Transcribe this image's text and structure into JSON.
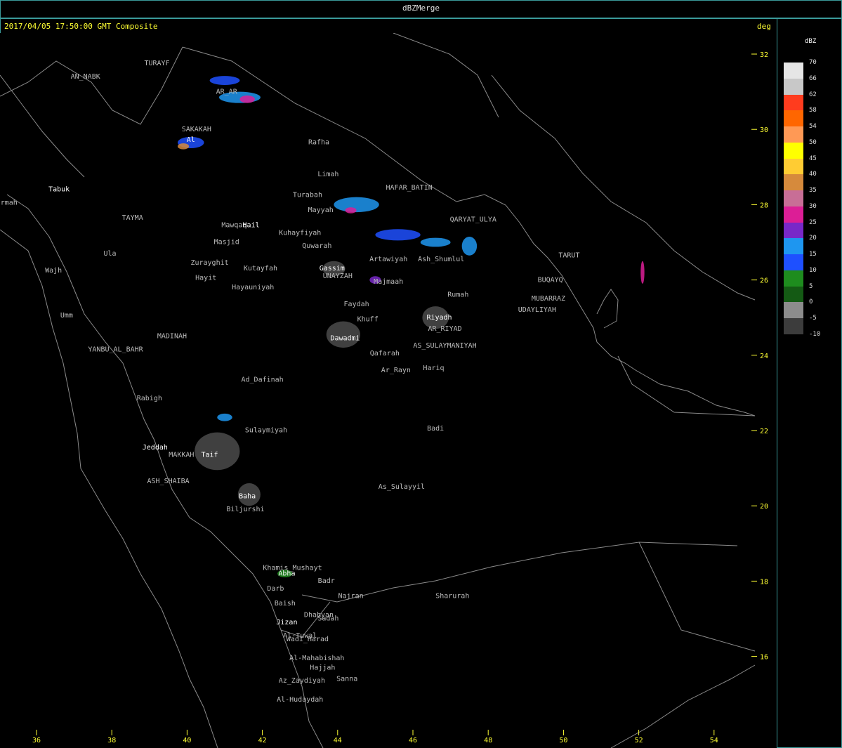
{
  "window": {
    "title": "dBZMerge"
  },
  "header": {
    "timestamp": "2017/04/05 17:50:00 GMT Composite"
  },
  "axes": {
    "unit": "deg",
    "lat_ticks": [
      "32",
      "30",
      "28",
      "26",
      "24",
      "22",
      "20",
      "18",
      "16"
    ],
    "lon_ticks": [
      "36",
      "38",
      "40",
      "42",
      "44",
      "46",
      "48",
      "50",
      "52",
      "54"
    ]
  },
  "legend": {
    "title": "dBZ",
    "levels": [
      {
        "label": "70",
        "color": "#e6e6e6"
      },
      {
        "label": "66",
        "color": "#c8c8c8"
      },
      {
        "label": "62",
        "color": "#ff3c1e"
      },
      {
        "label": "58",
        "color": "#ff6600"
      },
      {
        "label": "54",
        "color": "#ff9955"
      },
      {
        "label": "50",
        "color": "#ffff00"
      },
      {
        "label": "45",
        "color": "#ffcc33"
      },
      {
        "label": "40",
        "color": "#d68a3c"
      },
      {
        "label": "35",
        "color": "#c86e96"
      },
      {
        "label": "30",
        "color": "#dc1e96"
      },
      {
        "label": "25",
        "color": "#7828c8"
      },
      {
        "label": "20",
        "color": "#1e96f0"
      },
      {
        "label": "15",
        "color": "#1e50ff"
      },
      {
        "label": "10",
        "color": "#1e8c1e"
      },
      {
        "label": "5",
        "color": "#145a14"
      },
      {
        "label": "0",
        "color": "#8c8c8c"
      },
      {
        "label": "-5",
        "color": "#3c3c3c"
      }
    ],
    "min_label": "-10"
  },
  "places": [
    {
      "name": "TURAYF",
      "lon": 39.2,
      "lat": 31.7,
      "color": "#bbbbbb"
    },
    {
      "name": "AN_NABK",
      "lon": 37.3,
      "lat": 31.35,
      "color": "#bbbbbb"
    },
    {
      "name": "AR_AR",
      "lon": 41.05,
      "lat": 30.95,
      "color": "#bbbbbb"
    },
    {
      "name": "SAKAKAH",
      "lon": 40.25,
      "lat": 29.95,
      "color": "#bbbbbb"
    },
    {
      "name": "Al",
      "lon": 40.1,
      "lat": 29.67,
      "color": "#ffffff"
    },
    {
      "name": "Rafha",
      "lon": 43.5,
      "lat": 29.6,
      "color": "#bbbbbb"
    },
    {
      "name": "Limah",
      "lon": 43.75,
      "lat": 28.75,
      "color": "#bbbbbb"
    },
    {
      "name": "HAFAR_BATIN",
      "lon": 45.9,
      "lat": 28.4,
      "color": "#bbbbbb"
    },
    {
      "name": "Tabuk",
      "lon": 36.6,
      "lat": 28.35,
      "color": "#ffffff"
    },
    {
      "name": "Sharmah",
      "lon": 35.1,
      "lat": 28.0,
      "color": "#bbbbbb"
    },
    {
      "name": "Turabah",
      "lon": 43.2,
      "lat": 28.2,
      "color": "#bbbbbb"
    },
    {
      "name": "Mayyah",
      "lon": 43.55,
      "lat": 27.8,
      "color": "#bbbbbb"
    },
    {
      "name": "TAYMA",
      "lon": 38.55,
      "lat": 27.6,
      "color": "#bbbbbb"
    },
    {
      "name": "QARYAT_ULYA",
      "lon": 47.6,
      "lat": 27.55,
      "color": "#bbbbbb"
    },
    {
      "name": "Mawqaq",
      "lon": 41.25,
      "lat": 27.4,
      "color": "#bbbbbb"
    },
    {
      "name": "Hail",
      "lon": 41.7,
      "lat": 27.4,
      "color": "#ffffff"
    },
    {
      "name": "Kuhayfiyah",
      "lon": 43.0,
      "lat": 27.2,
      "color": "#bbbbbb"
    },
    {
      "name": "Masjid",
      "lon": 41.05,
      "lat": 26.95,
      "color": "#bbbbbb"
    },
    {
      "name": "Quwarah",
      "lon": 43.45,
      "lat": 26.85,
      "color": "#bbbbbb"
    },
    {
      "name": "Ula",
      "lon": 37.95,
      "lat": 26.65,
      "color": "#bbbbbb"
    },
    {
      "name": "Artawiyah",
      "lon": 45.35,
      "lat": 26.5,
      "color": "#bbbbbb"
    },
    {
      "name": "Ash_Shumlul",
      "lon": 46.75,
      "lat": 26.5,
      "color": "#bbbbbb"
    },
    {
      "name": "TARUT",
      "lon": 50.15,
      "lat": 26.6,
      "color": "#bbbbbb"
    },
    {
      "name": "Zurayghit",
      "lon": 40.6,
      "lat": 26.4,
      "color": "#bbbbbb"
    },
    {
      "name": "Kutayfah",
      "lon": 41.95,
      "lat": 26.25,
      "color": "#bbbbbb"
    },
    {
      "name": "Gassim",
      "lon": 43.85,
      "lat": 26.25,
      "color": "#ffffff"
    },
    {
      "name": "UNAYZAH",
      "lon": 44.0,
      "lat": 26.05,
      "color": "#bbbbbb"
    },
    {
      "name": "Wajh",
      "lon": 36.45,
      "lat": 26.2,
      "color": "#bbbbbb"
    },
    {
      "name": "Hayit",
      "lon": 40.5,
      "lat": 26.0,
      "color": "#bbbbbb"
    },
    {
      "name": "Majmaah",
      "lon": 45.35,
      "lat": 25.9,
      "color": "#bbbbbb"
    },
    {
      "name": "BUQAYQ",
      "lon": 49.65,
      "lat": 25.95,
      "color": "#bbbbbb"
    },
    {
      "name": "Hayauniyah",
      "lon": 41.75,
      "lat": 25.75,
      "color": "#bbbbbb"
    },
    {
      "name": "Rumah",
      "lon": 47.2,
      "lat": 25.55,
      "color": "#bbbbbb"
    },
    {
      "name": "MUBARRAZ",
      "lon": 49.6,
      "lat": 25.45,
      "color": "#bbbbbb"
    },
    {
      "name": "Faydah",
      "lon": 44.5,
      "lat": 25.3,
      "color": "#bbbbbb"
    },
    {
      "name": "UDAYLIYAH",
      "lon": 49.3,
      "lat": 25.15,
      "color": "#bbbbbb"
    },
    {
      "name": "Umm",
      "lon": 36.8,
      "lat": 25.0,
      "color": "#bbbbbb"
    },
    {
      "name": "Riyadh",
      "lon": 46.7,
      "lat": 24.95,
      "color": "#ffffff"
    },
    {
      "name": "Khuff",
      "lon": 44.8,
      "lat": 24.9,
      "color": "#bbbbbb"
    },
    {
      "name": "AR_RIYAD",
      "lon": 46.85,
      "lat": 24.65,
      "color": "#bbbbbb"
    },
    {
      "name": "MADINAH",
      "lon": 39.6,
      "lat": 24.45,
      "color": "#bbbbbb"
    },
    {
      "name": "Dawadmi",
      "lon": 44.2,
      "lat": 24.4,
      "color": "#ffffff"
    },
    {
      "name": "AS_SULAYMANIYAH",
      "lon": 46.85,
      "lat": 24.2,
      "color": "#bbbbbb"
    },
    {
      "name": "YANBU_AL_BAHR",
      "lon": 38.1,
      "lat": 24.1,
      "color": "#bbbbbb"
    },
    {
      "name": "Qafarah",
      "lon": 45.25,
      "lat": 24.0,
      "color": "#bbbbbb"
    },
    {
      "name": "Hariq",
      "lon": 46.55,
      "lat": 23.6,
      "color": "#bbbbbb"
    },
    {
      "name": "Ar_Rayn",
      "lon": 45.55,
      "lat": 23.55,
      "color": "#bbbbbb"
    },
    {
      "name": "Ad_Dafinah",
      "lon": 42.0,
      "lat": 23.3,
      "color": "#bbbbbb"
    },
    {
      "name": "Rabigh",
      "lon": 39.0,
      "lat": 22.8,
      "color": "#bbbbbb"
    },
    {
      "name": "Badi",
      "lon": 46.6,
      "lat": 22.0,
      "color": "#bbbbbb"
    },
    {
      "name": "Sulaymiyah",
      "lon": 42.1,
      "lat": 21.95,
      "color": "#bbbbbb"
    },
    {
      "name": "Jeddah",
      "lon": 39.15,
      "lat": 21.5,
      "color": "#ffffff"
    },
    {
      "name": "MAKKAH",
      "lon": 39.85,
      "lat": 21.3,
      "color": "#bbbbbb"
    },
    {
      "name": "Taif",
      "lon": 40.6,
      "lat": 21.3,
      "color": "#ffffff"
    },
    {
      "name": "ASH_SHAIBA",
      "lon": 39.5,
      "lat": 20.6,
      "color": "#bbbbbb"
    },
    {
      "name": "As_Sulayyil",
      "lon": 45.7,
      "lat": 20.45,
      "color": "#bbbbbb"
    },
    {
      "name": "Baha",
      "lon": 41.6,
      "lat": 20.2,
      "color": "#ffffff"
    },
    {
      "name": "Biljurshi",
      "lon": 41.55,
      "lat": 19.85,
      "color": "#bbbbbb"
    },
    {
      "name": "Khamis_Mushayt",
      "lon": 42.8,
      "lat": 18.3,
      "color": "#bbbbbb"
    },
    {
      "name": "Abha",
      "lon": 42.65,
      "lat": 18.15,
      "color": "#ffffff"
    },
    {
      "name": "Badr",
      "lon": 43.7,
      "lat": 17.95,
      "color": "#bbbbbb"
    },
    {
      "name": "Darb",
      "lon": 42.35,
      "lat": 17.75,
      "color": "#bbbbbb"
    },
    {
      "name": "Najran",
      "lon": 44.35,
      "lat": 17.55,
      "color": "#bbbbbb"
    },
    {
      "name": "Sharurah",
      "lon": 47.05,
      "lat": 17.55,
      "color": "#bbbbbb"
    },
    {
      "name": "Baish",
      "lon": 42.6,
      "lat": 17.35,
      "color": "#bbbbbb"
    },
    {
      "name": "Dhahyan",
      "lon": 43.5,
      "lat": 17.05,
      "color": "#bbbbbb"
    },
    {
      "name": "Sadah",
      "lon": 43.75,
      "lat": 16.95,
      "color": "#bbbbbb"
    },
    {
      "name": "Jizan",
      "lon": 42.65,
      "lat": 16.85,
      "color": "#ffffff"
    },
    {
      "name": "Al-Tuwal",
      "lon": 43.0,
      "lat": 16.5,
      "color": "#bbbbbb"
    },
    {
      "name": "Wadi_Harad",
      "lon": 43.2,
      "lat": 16.4,
      "color": "#bbbbbb"
    },
    {
      "name": "Al-Mahabishah",
      "lon": 43.45,
      "lat": 15.9,
      "color": "#bbbbbb"
    },
    {
      "name": "Hajjah",
      "lon": 43.6,
      "lat": 15.65,
      "color": "#bbbbbb"
    },
    {
      "name": "Az_Zaydiyah",
      "lon": 43.05,
      "lat": 15.3,
      "color": "#bbbbbb"
    },
    {
      "name": "Sanna",
      "lon": 44.25,
      "lat": 15.35,
      "color": "#bbbbbb"
    },
    {
      "name": "Al-Hudaydah",
      "lon": 43.0,
      "lat": 14.8,
      "color": "#bbbbbb"
    }
  ],
  "echoes": [
    {
      "lon": 41.0,
      "lat": 31.3,
      "rx": 0.4,
      "ry": 0.12,
      "dbz": 15
    },
    {
      "lon": 41.4,
      "lat": 30.85,
      "rx": 0.55,
      "ry": 0.15,
      "dbz": 20
    },
    {
      "lon": 41.6,
      "lat": 30.8,
      "rx": 0.2,
      "ry": 0.1,
      "dbz": 30
    },
    {
      "lon": 40.1,
      "lat": 29.65,
      "rx": 0.35,
      "ry": 0.15,
      "dbz": 15
    },
    {
      "lon": 39.9,
      "lat": 29.55,
      "rx": 0.15,
      "ry": 0.08,
      "dbz": 40
    },
    {
      "lon": 44.5,
      "lat": 28.0,
      "rx": 0.6,
      "ry": 0.2,
      "dbz": 20
    },
    {
      "lon": 44.35,
      "lat": 27.85,
      "rx": 0.15,
      "ry": 0.08,
      "dbz": 30
    },
    {
      "lon": 45.6,
      "lat": 27.2,
      "rx": 0.6,
      "ry": 0.15,
      "dbz": 15
    },
    {
      "lon": 46.6,
      "lat": 27.0,
      "rx": 0.4,
      "ry": 0.12,
      "dbz": 20
    },
    {
      "lon": 47.5,
      "lat": 26.9,
      "rx": 0.2,
      "ry": 0.25,
      "dbz": 20
    },
    {
      "lon": 45.0,
      "lat": 26.0,
      "rx": 0.15,
      "ry": 0.1,
      "dbz": 25
    },
    {
      "lon": 41.0,
      "lat": 22.35,
      "rx": 0.2,
      "ry": 0.1,
      "dbz": 20
    },
    {
      "lon": 42.6,
      "lat": 18.2,
      "rx": 0.2,
      "ry": 0.1,
      "dbz": 10
    },
    {
      "lon": 52.1,
      "lat": 26.2,
      "rx": 0.05,
      "ry": 0.3,
      "dbz": 30
    }
  ],
  "clutter": [
    {
      "lon": 44.15,
      "lat": 24.55,
      "rx": 0.45,
      "ry": 0.35
    },
    {
      "lon": 46.6,
      "lat": 25.0,
      "rx": 0.35,
      "ry": 0.3
    },
    {
      "lon": 40.8,
      "lat": 21.45,
      "rx": 0.6,
      "ry": 0.5
    },
    {
      "lon": 41.65,
      "lat": 20.3,
      "rx": 0.3,
      "ry": 0.3
    },
    {
      "lon": 43.9,
      "lat": 26.3,
      "rx": 0.3,
      "ry": 0.2
    }
  ]
}
